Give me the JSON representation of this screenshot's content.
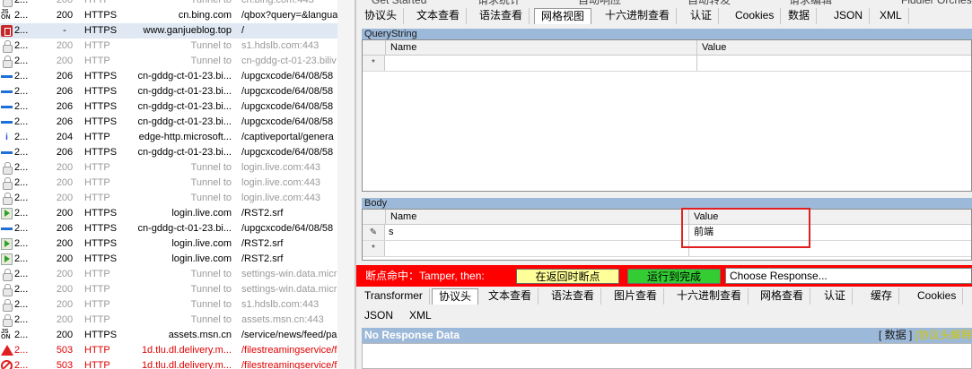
{
  "sessions": [
    {
      "num": "2...",
      "result": "200",
      "protocol": "HTTP",
      "host": "Tunnel to",
      "url": "cn.bing.com:443",
      "style": "tun",
      "icon": "lock"
    },
    {
      "num": "2...",
      "result": "200",
      "protocol": "HTTPS",
      "host": "cn.bing.com",
      "url": "/qbox?query=&langua",
      "style": "",
      "icon": "js"
    },
    {
      "num": "2...",
      "result": "-",
      "protocol": "HTTPS",
      "host": "www.ganjueblog.top",
      "url": "/",
      "style": "",
      "icon": "red",
      "selected": true
    },
    {
      "num": "2...",
      "result": "200",
      "protocol": "HTTP",
      "host": "Tunnel to",
      "url": "s1.hdslb.com:443",
      "style": "tun",
      "icon": "lock"
    },
    {
      "num": "2...",
      "result": "200",
      "protocol": "HTTP",
      "host": "Tunnel to",
      "url": "cn-gddg-ct-01-23.biliv",
      "style": "tun",
      "icon": "lock"
    },
    {
      "num": "2...",
      "result": "206",
      "protocol": "HTTPS",
      "host": "cn-gddg-ct-01-23.bi...",
      "url": "/upgcxcode/64/08/58",
      "style": "",
      "icon": "stream"
    },
    {
      "num": "2...",
      "result": "206",
      "protocol": "HTTPS",
      "host": "cn-gddg-ct-01-23.bi...",
      "url": "/upgcxcode/64/08/58",
      "style": "",
      "icon": "stream"
    },
    {
      "num": "2...",
      "result": "206",
      "protocol": "HTTPS",
      "host": "cn-gddg-ct-01-23.bi...",
      "url": "/upgcxcode/64/08/58",
      "style": "",
      "icon": "stream"
    },
    {
      "num": "2...",
      "result": "206",
      "protocol": "HTTPS",
      "host": "cn-gddg-ct-01-23.bi...",
      "url": "/upgcxcode/64/08/58",
      "style": "",
      "icon": "stream"
    },
    {
      "num": "2...",
      "result": "204",
      "protocol": "HTTP",
      "host": "edge-http.microsoft...",
      "url": "/captiveportal/genera",
      "style": "",
      "icon": "info"
    },
    {
      "num": "2...",
      "result": "206",
      "protocol": "HTTPS",
      "host": "cn-gddg-ct-01-23.bi...",
      "url": "/upgcxcode/64/08/58",
      "style": "",
      "icon": "stream"
    },
    {
      "num": "2...",
      "result": "200",
      "protocol": "HTTP",
      "host": "Tunnel to",
      "url": "login.live.com:443",
      "style": "tun",
      "icon": "lock"
    },
    {
      "num": "2...",
      "result": "200",
      "protocol": "HTTP",
      "host": "Tunnel to",
      "url": "login.live.com:443",
      "style": "tun",
      "icon": "lock"
    },
    {
      "num": "2...",
      "result": "200",
      "protocol": "HTTP",
      "host": "Tunnel to",
      "url": "login.live.com:443",
      "style": "tun",
      "icon": "lock"
    },
    {
      "num": "2...",
      "result": "200",
      "protocol": "HTTPS",
      "host": "login.live.com",
      "url": "/RST2.srf",
      "style": "",
      "icon": "arrow"
    },
    {
      "num": "2...",
      "result": "206",
      "protocol": "HTTPS",
      "host": "cn-gddg-ct-01-23.bi...",
      "url": "/upgcxcode/64/08/58",
      "style": "",
      "icon": "stream"
    },
    {
      "num": "2...",
      "result": "200",
      "protocol": "HTTPS",
      "host": "login.live.com",
      "url": "/RST2.srf",
      "style": "",
      "icon": "arrow"
    },
    {
      "num": "2...",
      "result": "200",
      "protocol": "HTTPS",
      "host": "login.live.com",
      "url": "/RST2.srf",
      "style": "",
      "icon": "arrow"
    },
    {
      "num": "2...",
      "result": "200",
      "protocol": "HTTP",
      "host": "Tunnel to",
      "url": "settings-win.data.micr",
      "style": "tun",
      "icon": "lock"
    },
    {
      "num": "2...",
      "result": "200",
      "protocol": "HTTP",
      "host": "Tunnel to",
      "url": "settings-win.data.micr",
      "style": "tun",
      "icon": "lock"
    },
    {
      "num": "2...",
      "result": "200",
      "protocol": "HTTP",
      "host": "Tunnel to",
      "url": "s1.hdslb.com:443",
      "style": "tun",
      "icon": "lock"
    },
    {
      "num": "2...",
      "result": "200",
      "protocol": "HTTP",
      "host": "Tunnel to",
      "url": "assets.msn.cn:443",
      "style": "tun",
      "icon": "lock"
    },
    {
      "num": "2...",
      "result": "200",
      "protocol": "HTTPS",
      "host": "assets.msn.cn",
      "url": "/service/news/feed/pa",
      "style": "",
      "icon": "js"
    },
    {
      "num": "2...",
      "result": "503",
      "protocol": "HTTP",
      "host": "1d.tlu.dl.delivery.m...",
      "url": "/filestreamingservice/f",
      "style": "err",
      "icon": "warn"
    },
    {
      "num": "2...",
      "result": "503",
      "protocol": "HTTP",
      "host": "1d.tlu.dl.delivery.m...",
      "url": "/filestreamingservice/f",
      "style": "err",
      "icon": "block"
    }
  ],
  "top_partial_tabs": [
    "Get Started",
    "请求统计",
    "自动响应",
    "自动转发",
    "请求编辑",
    "Fiddler Orchestra"
  ],
  "request_tabs": [
    "协议头",
    "文本查看",
    "语法查看",
    "网格视图",
    "十六进制查看",
    "认证",
    "Cookies",
    "数据",
    "JSON",
    "XML"
  ],
  "request_active_tab": "网格视图",
  "querystring": {
    "title": "QueryString",
    "col_name": "Name",
    "col_value": "Value",
    "new_row_marker": "*"
  },
  "body": {
    "title": "Body",
    "col_name": "Name",
    "col_value": "Value",
    "rows": [
      {
        "marker": "✎",
        "name": "s",
        "value": "前端"
      }
    ],
    "new_row_marker": "*"
  },
  "breakpoint": {
    "label": "断点命中：Tamper, then:",
    "btn_break_on_response": "在返回时断点",
    "btn_run_to_completion": "运行到完成",
    "choose_response": "Choose Response...",
    "colors": {
      "bar": "#ff0000",
      "btn_yellow": "#ffff99",
      "btn_green": "#33cc33"
    }
  },
  "response_tabs_row1": [
    "Transformer",
    "协议头",
    "文本查看",
    "语法查看",
    "图片查看",
    "十六进制查看",
    "网格查看",
    "认证",
    "缓存",
    "Cookies"
  ],
  "response_tabs_row2": [
    "JSON",
    "XML"
  ],
  "response_active_tab": "协议头",
  "response": {
    "title": "No Response Data",
    "link_data": "[ 数据 ]",
    "link_headers": "[协议头解释"
  }
}
